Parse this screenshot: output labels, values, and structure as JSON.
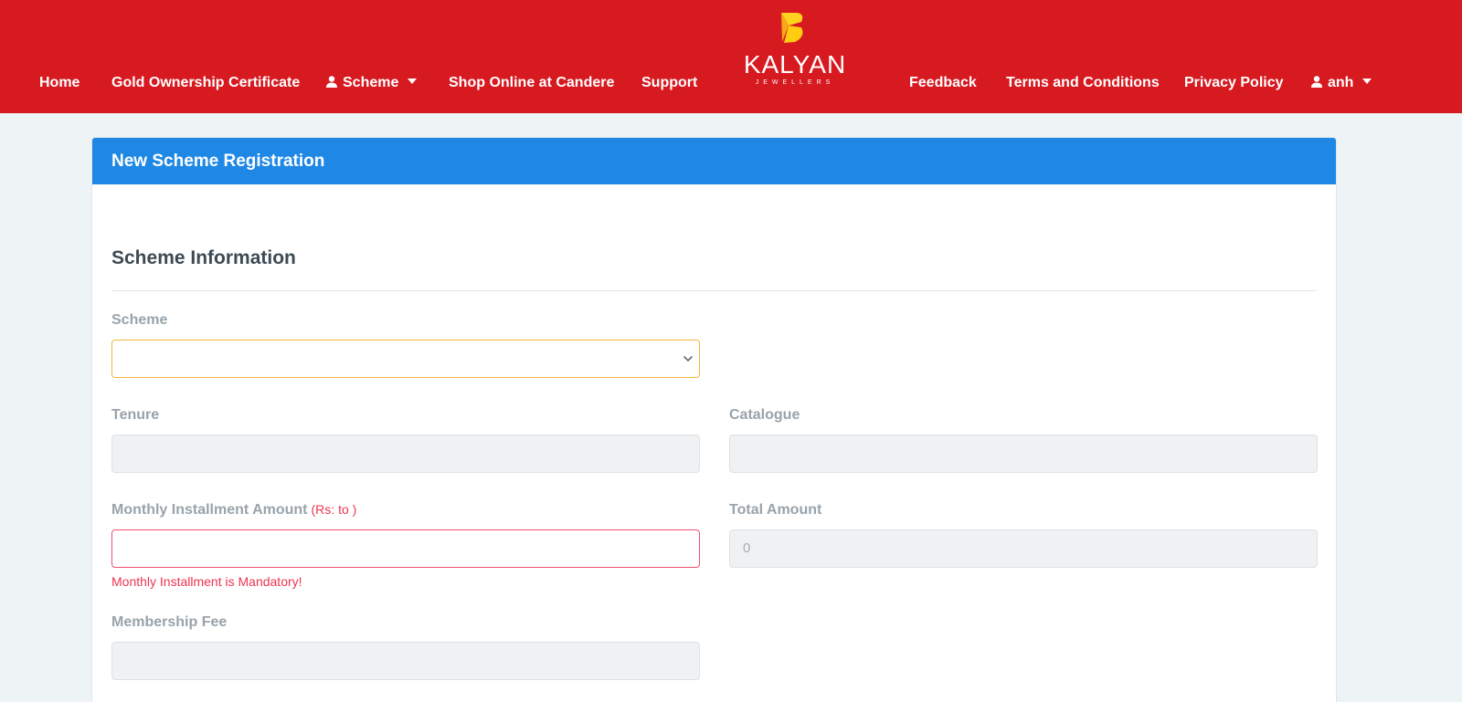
{
  "nav": {
    "home": "Home",
    "gold_certificate": "Gold Ownership Certificate",
    "scheme": "Scheme",
    "shop_online": "Shop Online at Candere",
    "support": "Support",
    "feedback": "Feedback",
    "terms": "Terms and Conditions",
    "privacy": "Privacy Policy",
    "user": "anh"
  },
  "logo": {
    "word": "KALYAN",
    "sub": "JEWELLERS"
  },
  "card": {
    "title": "New Scheme Registration"
  },
  "section": {
    "title": "Scheme Information"
  },
  "form": {
    "scheme_label": "Scheme",
    "scheme_value": "",
    "tenure_label": "Tenure",
    "tenure_value": "",
    "catalogue_label": "Catalogue",
    "catalogue_value": "",
    "monthly_label": "Monthly Installment Amount",
    "monthly_hint": "(Rs: to )",
    "monthly_value": "",
    "monthly_error": "Monthly Installment is Mandatory!",
    "total_label": "Total Amount",
    "total_value": "0",
    "membership_label": "Membership Fee",
    "membership_value": ""
  },
  "colors": {
    "nav_bg": "#d71920",
    "header_bg": "#1f88e5",
    "error": "#ee3450",
    "select_border": "#f4b63c"
  },
  "icons": {
    "user": "person-icon",
    "dropdown": "caret-down-icon",
    "select": "chevron-down-icon",
    "logo": "kalyan-leaf-logo"
  }
}
